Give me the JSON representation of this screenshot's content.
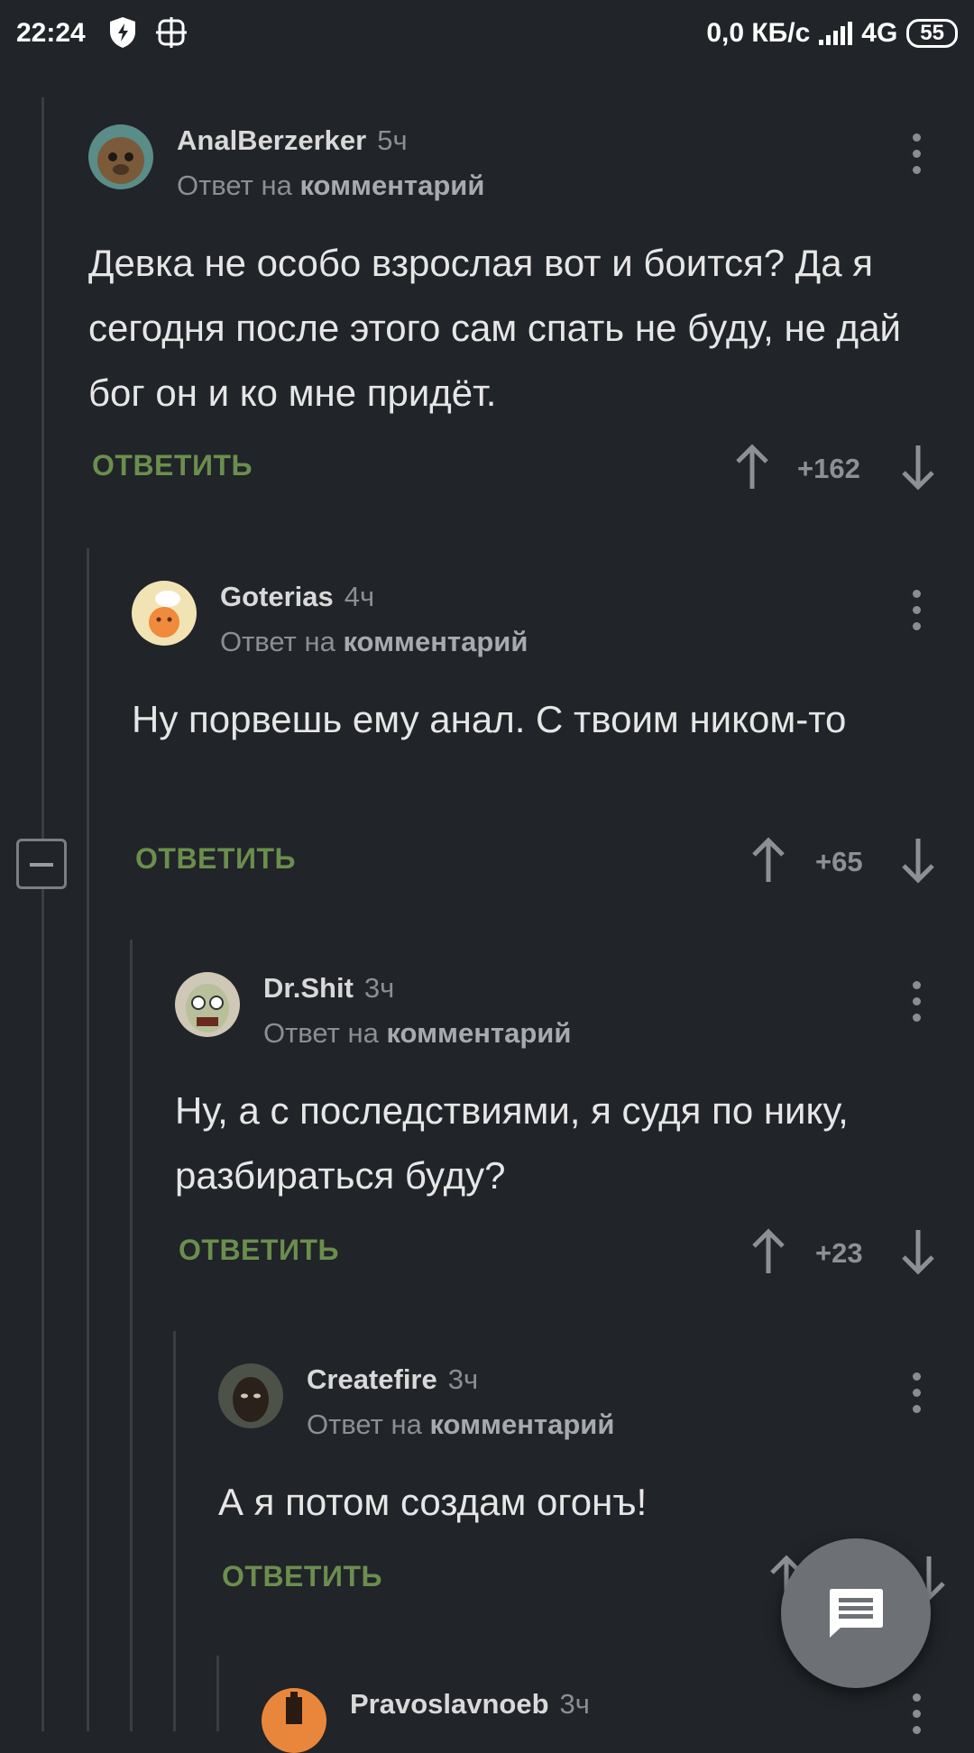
{
  "status_bar": {
    "time": "22:24",
    "speed": "0,0 КБ/с",
    "network": "4G",
    "battery": "55"
  },
  "reply_label": "ОТВЕТИТЬ",
  "reply_to_prefix": "Ответ на",
  "reply_to_target": "комментарий",
  "comments": [
    {
      "username": "AnalBerzerker",
      "time": "5ч",
      "text": "Девка не особо взрослая вот и боится? Да я сегодня после этого сам спать не буду, не дай бог он и ко мне придёт.",
      "rating": "+162"
    },
    {
      "username": "Goterias",
      "time": "4ч",
      "text": "Ну порвешь ему анал. С твоим ником-то",
      "rating": "+65"
    },
    {
      "username": "Dr.Shit",
      "time": "3ч",
      "text": "Ну, а с последствиями, я судя по нику, разбираться буду?",
      "rating": "+23"
    },
    {
      "username": "Createfire",
      "time": "3ч",
      "text": "А я потом создам огонъ!",
      "rating": ""
    },
    {
      "username": "Pravoslavnoeb",
      "time": "3ч",
      "text": "",
      "rating": ""
    }
  ],
  "colors": {
    "background": "#212428",
    "reply_green": "#6b8e4e",
    "muted": "#8b8e92"
  },
  "icons": {
    "vote_up": "arrow-up-icon",
    "vote_down": "arrow-down-icon",
    "more": "more-vertical-icon",
    "collapse": "minus-square-icon",
    "fab": "comment-icon"
  }
}
